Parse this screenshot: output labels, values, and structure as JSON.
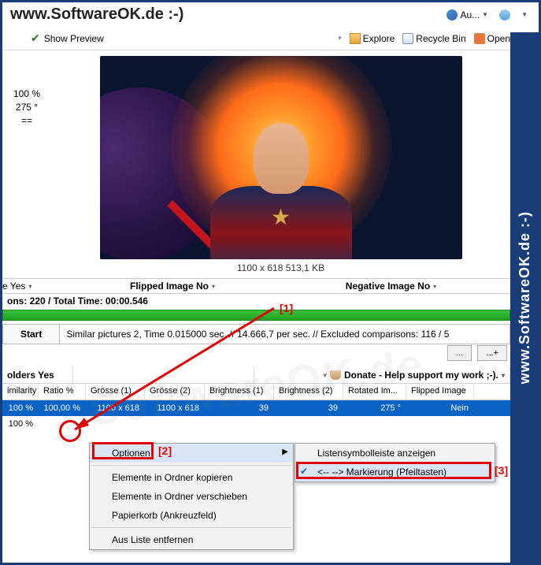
{
  "title": "www.SoftwareOK.de :-)",
  "side_label": "www.SoftwareOK.de :-)",
  "titlebar": {
    "au_label": "Au..."
  },
  "toolbar": {
    "show_preview": "Show Preview",
    "explore": "Explore",
    "recycle": "Recycle Bin",
    "open": "Open"
  },
  "left_info": {
    "percent": "100 %",
    "degrees": "275 °",
    "eq": "=="
  },
  "image_caption": "1100 x 618 513,1 KB",
  "filters": {
    "col1_suffix": "e Yes",
    "col2": "Flipped Image No",
    "col3": "Negative Image No"
  },
  "stats": "ons: 220 / Total Time: 00:00.546",
  "start_label": "Start",
  "status_text": "Similar pictures 2, Time 0.015000 sec. // 14.666,7 per sec. // Excluded comparisons: 116 / 5",
  "btn_dots": "...",
  "btn_plus": "...+",
  "sections": {
    "folders": "olders Yes",
    "donate": "Donate - Help support my work ;-)."
  },
  "headers": {
    "sim": "imilarity",
    "ratio": "Ratio %",
    "g1": "Grösse (1)",
    "g2": "Grösse (2)",
    "b1": "Brightness (1)",
    "b2": "Brightness (2)",
    "rot": "Rotated Im...",
    "flip": "Flipped Image"
  },
  "rows": [
    {
      "sim": "100 %",
      "ratio": "100,00 %",
      "g1": "1100 x 618",
      "g2": "1100 x 618",
      "b1": "39",
      "b2": "39",
      "rot": "275 °",
      "flip": "Nein"
    },
    {
      "sim": "100 %",
      "ratio": "",
      "g1": "",
      "g2": "",
      "b1": "",
      "b2": "",
      "rot": "",
      "flip": ""
    }
  ],
  "menu1": {
    "optionen": "Optionen",
    "copy": "Elemente in Ordner kopieren",
    "move": "Elemente in Ordner verschieben",
    "trash": "Papierkorb (Ankreuzfeld)",
    "remove": "Aus Liste entfernen"
  },
  "menu2": {
    "listbar": "Listensymbolleiste anzeigen",
    "arrows": "<-- --> Markierung (Pfeiltasten)"
  },
  "anno": {
    "n1": "[1]",
    "n2": "[2]",
    "n3": "[3]"
  },
  "watermark": "SoftwareOK.de"
}
